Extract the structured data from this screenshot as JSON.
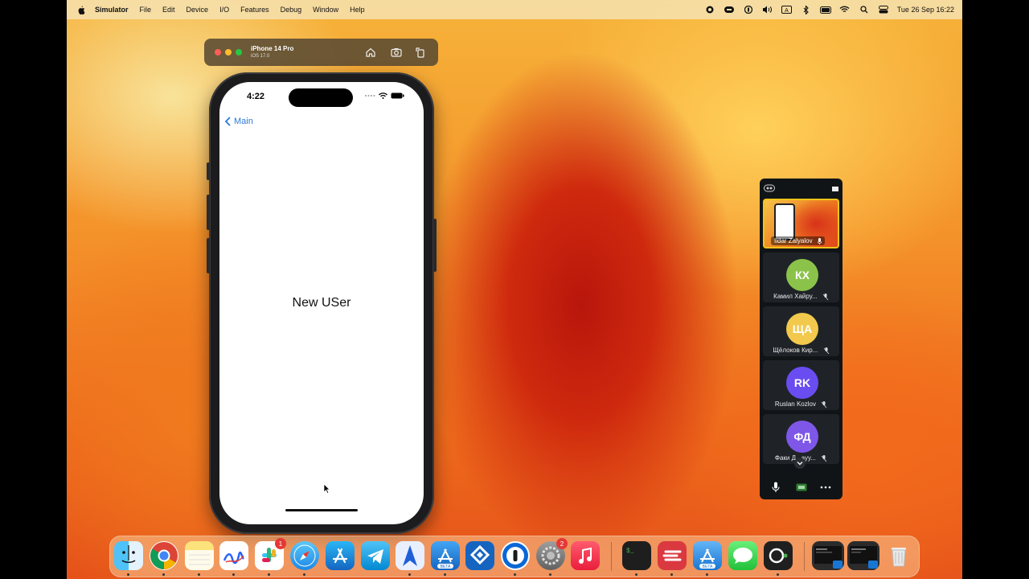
{
  "menubar": {
    "app_name": "Simulator",
    "items": [
      "File",
      "Edit",
      "Device",
      "I/O",
      "Features",
      "Debug",
      "Window",
      "Help"
    ],
    "clock": "Tue 26 Sep  16:22"
  },
  "simulator": {
    "device_name": "iPhone 14 Pro",
    "os_version": "iOS 17.0"
  },
  "phone": {
    "time": "4:22",
    "back_label": "Main",
    "center_text": "New USer"
  },
  "meeting": {
    "participants": [
      {
        "name": "Ildar Zalyalov",
        "initials": "",
        "color": "",
        "active": true
      },
      {
        "name": "Камил Хайру...",
        "initials": "КХ",
        "color": "#8bc34a"
      },
      {
        "name": "Щёлоков Кир...",
        "initials": "ЩА",
        "color": "#f2c94c"
      },
      {
        "name": "Ruslan Kozlov",
        "initials": "RK",
        "color": "#6a4df0"
      },
      {
        "name": "Факи Д...ауу...",
        "initials": "ФД",
        "color": "#7e57e8"
      }
    ]
  },
  "dock": {
    "apps": [
      "finder-icon",
      "chrome-icon",
      "notes-icon",
      "freeform-icon",
      "slack-icon",
      "safari-icon",
      "app-store-icon",
      "telegram-icon",
      "spark-icon",
      "xcode-beta-icon",
      "jira-icon",
      "1password-icon",
      "system-settings-icon",
      "music-icon",
      "terminal-icon",
      "express-vpn-icon",
      "xcode-icon",
      "messages-icon",
      "screen-recorder-icon"
    ],
    "slack_badge": "1",
    "settings_badge": "2",
    "beta_label": "BETA"
  },
  "colors": {
    "accent_link": "#2c79d6",
    "dock_bg": "rgba(250,200,150,0.55)"
  }
}
